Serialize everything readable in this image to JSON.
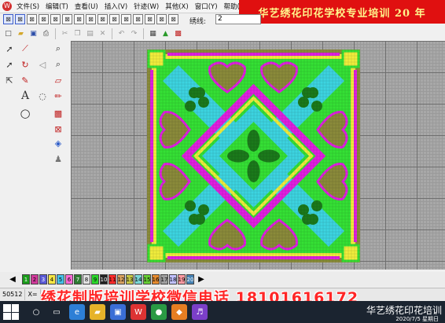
{
  "menu": {
    "items": [
      "文件(S)",
      "编辑(T)",
      "查看(U)",
      "插入(V)",
      "针迹(W)",
      "其他(X)",
      "窗口(Y)",
      "帮助(Z)"
    ]
  },
  "banner": {
    "text": "华艺绣花印花学校专业培训 20 年"
  },
  "toolbar": {
    "stitch_label": "绣线:",
    "stitch_value": "2"
  },
  "palette": {
    "numbers": [
      "1",
      "2",
      "3",
      "4",
      "5",
      "6",
      "7",
      "8",
      "9",
      "10",
      "11",
      "12",
      "13",
      "14",
      "15",
      "16",
      "17",
      "18",
      "19",
      "20"
    ],
    "colors": [
      "#1a9c1a",
      "#d03a9a",
      "#5a5ad6",
      "#f5e642",
      "#44c0e6",
      "#ff6ad6",
      "#2e7d32",
      "#e0e0e0",
      "#2ad62a",
      "#222222",
      "#ff2a2a",
      "#d6a060",
      "#c6c646",
      "#7ad6d6",
      "#66cc33",
      "#e68a2e",
      "#9e9e9e",
      "#c0c0ff",
      "#ff9aa2",
      "#4682b4"
    ]
  },
  "status": {
    "stitch_count": "50512",
    "coord_x": "X="
  },
  "watermark": {
    "text": "绣花制版培训学校微信电话 18101616172"
  },
  "taskbar": {
    "tray_text": "华艺绣花印花培训",
    "date": "2020/7/5 星期日"
  },
  "colors": {
    "banner_bg": "#e01010",
    "banner_fg": "#fff58c",
    "canvas_bg": "#a8a8a8",
    "green": "#35e035",
    "magenta": "#e020e0",
    "cyan": "#3cd4e0",
    "yellow": "#f0ec3c",
    "olive": "#8a8a3a"
  }
}
